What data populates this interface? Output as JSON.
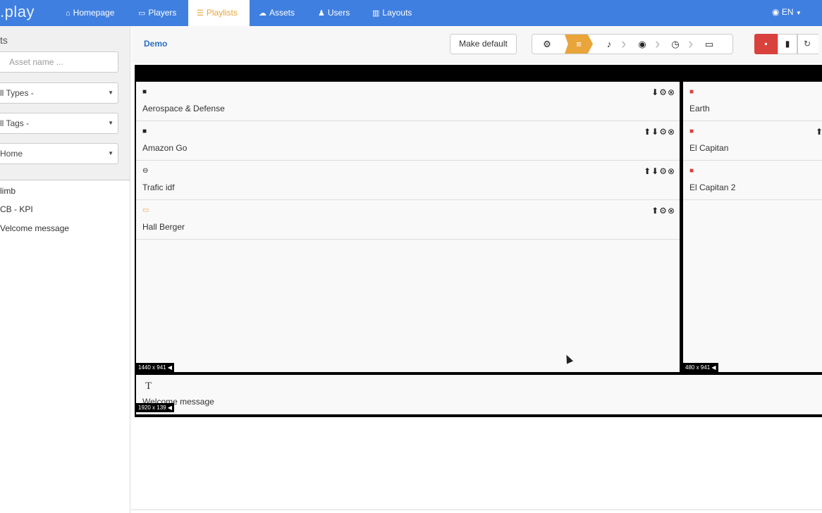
{
  "app": {
    "brand": ".play"
  },
  "nav": {
    "items": [
      {
        "icon": "home-icon",
        "glyph": "⌂",
        "label": "Homepage"
      },
      {
        "icon": "tv-icon",
        "glyph": "▭",
        "label": "Players"
      },
      {
        "icon": "list-icon",
        "glyph": "☰",
        "label": "Playlists",
        "active": true
      },
      {
        "icon": "cloud-icon",
        "glyph": "☁",
        "label": "Assets"
      },
      {
        "icon": "user-icon",
        "glyph": "♟",
        "label": "Users"
      },
      {
        "icon": "columns-icon",
        "glyph": "▥",
        "label": "Layouts"
      }
    ],
    "language": {
      "icon": "globe-icon",
      "label": "EN"
    }
  },
  "sidebar": {
    "title": "ts",
    "search_placeholder": "Asset name ...",
    "filters": [
      {
        "value": "ll Types -"
      },
      {
        "value": "ll Tags -"
      },
      {
        "value": "Home"
      }
    ],
    "playlists": [
      "limb",
      "CB - KPI",
      "Velcome message"
    ]
  },
  "header": {
    "playlist_name": "Demo",
    "make_default_label": "Make default",
    "steps": [
      {
        "icon": "settings-icon",
        "glyph": "⚙"
      },
      {
        "icon": "list-icon",
        "glyph": "≡",
        "active": true
      },
      {
        "icon": "music-icon",
        "glyph": "♪"
      },
      {
        "icon": "eye-icon",
        "glyph": "◉"
      },
      {
        "icon": "clock-icon",
        "glyph": "◷"
      },
      {
        "icon": "monitor-icon",
        "glyph": "▭"
      }
    ],
    "save_glyph": "▪",
    "trash_glyph": "▮",
    "refresh_glyph": "↻"
  },
  "zones": {
    "main": {
      "resolution": "1440 x 941",
      "items": [
        {
          "type_icon": "video-icon",
          "glyph": "■",
          "color": "",
          "name": "Aerospace & Defense",
          "controls": "⬇⚙⊗"
        },
        {
          "type_icon": "video-icon",
          "glyph": "■",
          "color": "",
          "name": "Amazon Go",
          "controls": "⬆⬇⚙⊗"
        },
        {
          "type_icon": "link-icon",
          "glyph": "⊖",
          "color": "",
          "name": "Trafic idf",
          "controls": "⬆⬇⚙⊗"
        },
        {
          "type_icon": "widget-icon",
          "glyph": "▭",
          "color": "yellow",
          "name": "Hall Berger",
          "controls": "⬆⚙⊗"
        }
      ]
    },
    "side": {
      "resolution": "480 x 941",
      "items": [
        {
          "type_icon": "image-icon",
          "glyph": "■",
          "color": "red",
          "name": "Earth",
          "controls": ""
        },
        {
          "type_icon": "image-icon",
          "glyph": "■",
          "color": "red",
          "name": "El Capitan",
          "controls": "⬆"
        },
        {
          "type_icon": "image-icon",
          "glyph": "■",
          "color": "red",
          "name": "El Capitan 2",
          "controls": ""
        }
      ]
    },
    "bottom": {
      "resolution": "1920 x 139",
      "text_glyph": "T",
      "item_name": "Welcome message"
    }
  },
  "colors": {
    "nav_bg": "#3f7fe0",
    "accent": "#e9a43a",
    "danger": "#d9413d",
    "link": "#2d6fbf"
  }
}
